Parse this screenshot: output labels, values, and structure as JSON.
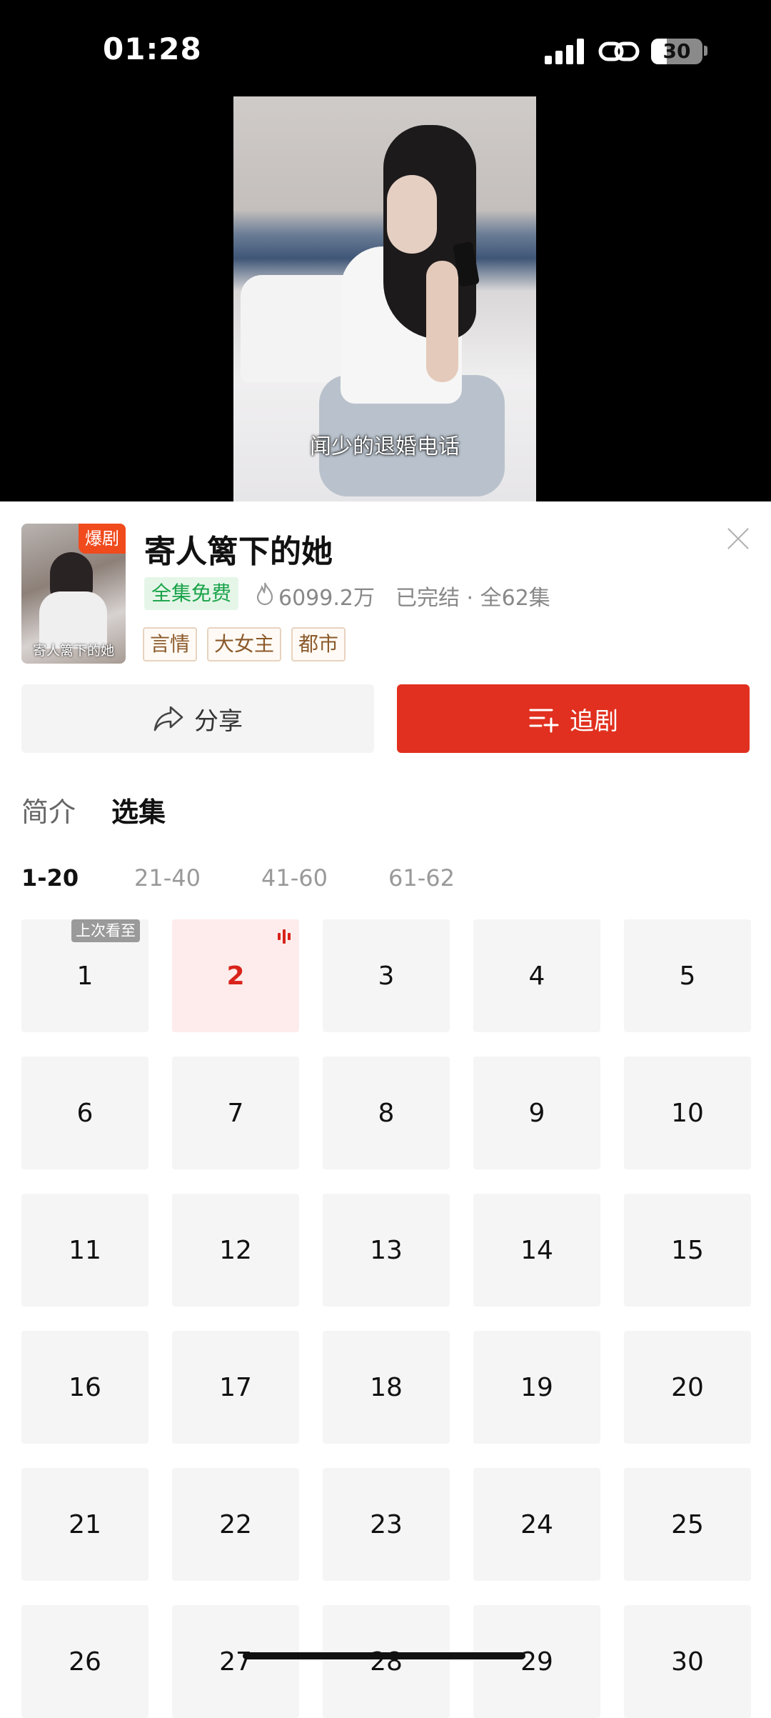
{
  "status_bar": {
    "time": "01:28",
    "battery": "30",
    "battery_level": 0.3,
    "icons": [
      "signal-icon",
      "link-icon",
      "battery-icon"
    ]
  },
  "video": {
    "subtitle": "闻少的退婚电话"
  },
  "drama": {
    "poster_badge": "爆剧",
    "poster_title": "寄人篱下的她",
    "title": "寄人篱下的她",
    "free_label": "全集免费",
    "views": "6099.2万",
    "status": "已完结 · 全62集",
    "tags": [
      "言情",
      "大女主",
      "都市"
    ]
  },
  "actions": {
    "share_label": "分享",
    "follow_label": "追剧"
  },
  "tabs": {
    "intro": "简介",
    "episodes": "选集"
  },
  "ranges": [
    "1-20",
    "21-40",
    "41-60",
    "61-62"
  ],
  "episodes": {
    "last_watched_label": "上次看至",
    "numbers": [
      "1",
      "2",
      "3",
      "4",
      "5",
      "6",
      "7",
      "8",
      "9",
      "10",
      "11",
      "12",
      "13",
      "14",
      "15",
      "16",
      "17",
      "18",
      "19",
      "20",
      "21",
      "22",
      "23",
      "24",
      "25",
      "26",
      "27",
      "28",
      "29",
      "30"
    ],
    "current": "2"
  },
  "colors": {
    "accent": "#e1301f",
    "free_green": "#1aa34a",
    "tag_brown": "#8b5a2b"
  }
}
